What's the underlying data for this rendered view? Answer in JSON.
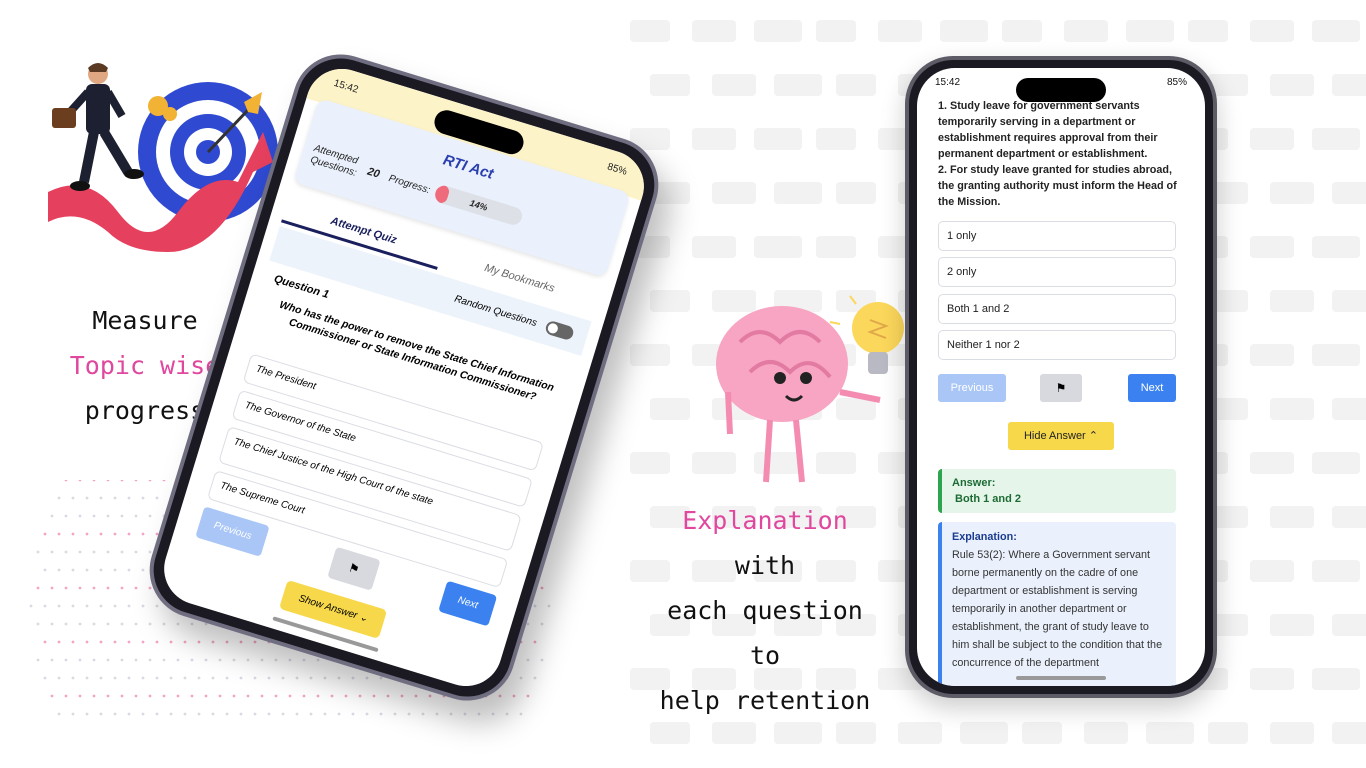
{
  "captions": {
    "left": {
      "line1": "Measure",
      "line2": "Topic wise",
      "line3": "progress"
    },
    "right": {
      "line1_highlight": "Explanation",
      "line1_rest": " with",
      "line2": "each question to",
      "line3": "help retention"
    }
  },
  "colors": {
    "accent_pink": "#e0479e",
    "primary_blue": "#3b82f0",
    "answer_yellow": "#f7d84b",
    "correct_green": "#2ea44f"
  },
  "left_phone": {
    "status_time": "15:42",
    "status_right": "85%",
    "title": "RTI Act",
    "attempted_label": "Attempted Questions:",
    "attempted_value": "20",
    "progress_label": "Progress:",
    "progress_value": 14,
    "progress_text": "14%",
    "tabs": {
      "attempt": "Attempt Quiz",
      "bookmarks": "My Bookmarks"
    },
    "random_label": "Random Questions",
    "question_label": "Question 1",
    "question_text": "Who has the power to remove the State Chief Information Commissioner or State Information Commissioner?",
    "options": [
      "The President",
      "The Governor of the State",
      "The Chief Justice of the High Court of the state",
      "The Supreme Court"
    ],
    "prev_label": "Previous",
    "next_label": "Next",
    "show_answer_label": "Show Answer",
    "bookmark_icon": "bookmark-icon",
    "chevron_icon": "chevron-down-icon"
  },
  "right_phone": {
    "status_time": "15:42",
    "status_right": "85%",
    "question_text": "1. Study leave for government servants temporarily serving in a department or establishment requires approval from their permanent department or establishment.\n2. For study leave granted for studies abroad, the granting authority must inform the Head of the Mission.",
    "options": [
      "1 only",
      "2 only",
      "Both 1 and 2",
      "Neither 1 nor 2"
    ],
    "prev_label": "Previous",
    "next_label": "Next",
    "hide_answer_label": "Hide Answer",
    "answer_heading": "Answer:",
    "answer_value": "Both 1 and 2",
    "explanation_heading": "Explanation:",
    "explanation_text": "Rule 53(2): Where a Government servant borne permanently on the cadre of one department or establishment is serving temporarily in another department or establishment, the grant of study leave to him shall be subject to the condition that the concurrence of the department"
  }
}
